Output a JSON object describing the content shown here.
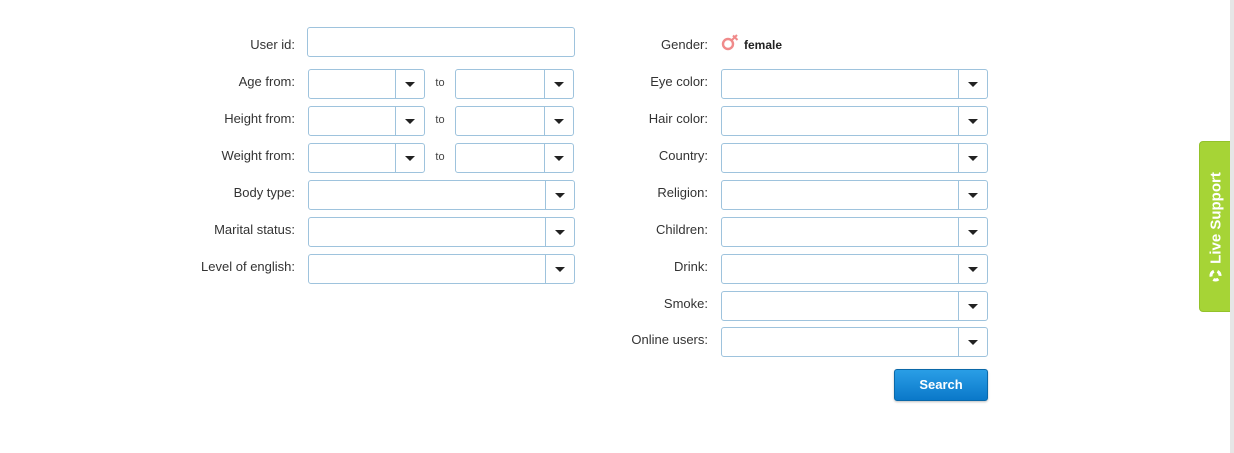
{
  "left": {
    "user_id": {
      "label": "User id:",
      "value": ""
    },
    "age": {
      "label": "Age from:",
      "from": "",
      "to": ""
    },
    "height": {
      "label": "Height from:",
      "from": "",
      "to": ""
    },
    "weight": {
      "label": "Weight from:",
      "from": "",
      "to": ""
    },
    "to_label": "to",
    "body_type": {
      "label": "Body type:",
      "value": ""
    },
    "marital_status": {
      "label": "Marital status:",
      "value": ""
    },
    "level_of_english": {
      "label": "Level of english:",
      "value": ""
    }
  },
  "right": {
    "gender": {
      "label": "Gender:",
      "value": "female",
      "icon": "female-symbol-icon"
    },
    "eye_color": {
      "label": "Eye color:",
      "value": ""
    },
    "hair_color": {
      "label": "Hair color:",
      "value": ""
    },
    "country": {
      "label": "Country:",
      "value": ""
    },
    "religion": {
      "label": "Religion:",
      "value": ""
    },
    "children": {
      "label": "Children:",
      "value": ""
    },
    "drink": {
      "label": "Drink:",
      "value": ""
    },
    "smoke": {
      "label": "Smoke:",
      "value": ""
    },
    "online_users": {
      "label": "Online users:",
      "value": ""
    }
  },
  "search_button": {
    "label": "Search"
  },
  "live_support": {
    "label": "Live Support",
    "icon": "lifebuoy-icon"
  },
  "colors": {
    "field_border": "#9ec3dd",
    "search_button": "#0a78c9",
    "live_support": "#a6d436",
    "gender_icon": "#f08a8a"
  }
}
